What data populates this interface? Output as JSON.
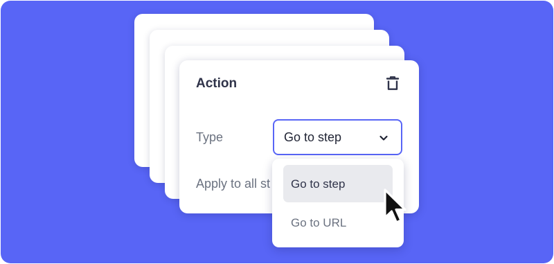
{
  "card": {
    "title": "Action",
    "delete_icon": "trash-icon"
  },
  "fields": {
    "type_label": "Type",
    "apply_label": "Apply to all st"
  },
  "select": {
    "value": "Go to step",
    "chevron_icon": "chevron-down-icon"
  },
  "dropdown": {
    "options": [
      {
        "label": "Go to step",
        "highlighted": true
      },
      {
        "label": "Go to URL",
        "highlighted": false
      }
    ]
  },
  "colors": {
    "background": "#5865f6",
    "accent": "#5865f6",
    "card": "#ffffff",
    "highlight": "#e9eaee"
  }
}
